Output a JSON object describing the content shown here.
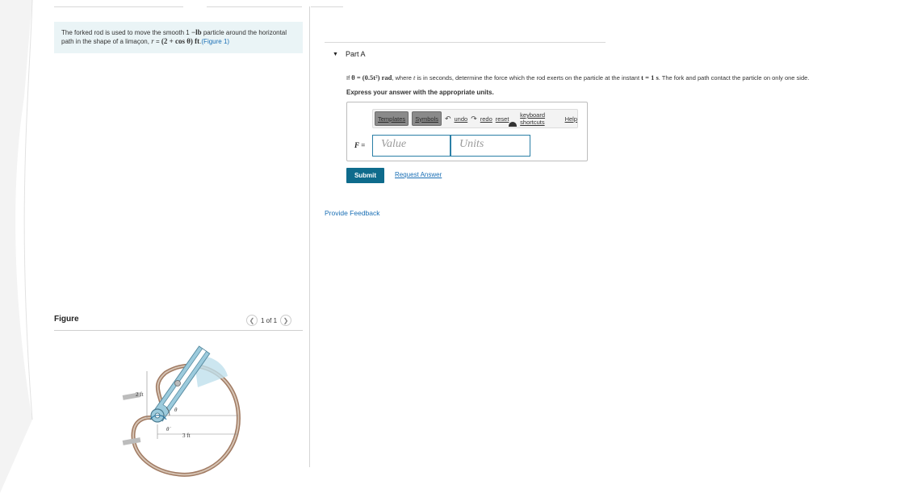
{
  "problem": {
    "text_1": "The forked rod is used to move the smooth 1",
    "weight_unit": "−lb",
    "text_2": "particle around the horizontal path in the shape of a limaçon,",
    "equation_r": "r",
    "equation_eq": " = ",
    "equation_expr": "(2 + cos θ) ft",
    "period": ".",
    "figure_link": "(Figure 1)"
  },
  "figure": {
    "title": "Figure",
    "page_indicator": "1 of 1",
    "prev_icon": "chevron-left-icon",
    "next_icon": "chevron-right-icon",
    "labels": {
      "two_ft": "2 ft",
      "three_ft": "3 ft",
      "theta": "θ",
      "theta_dot": "θ̇"
    }
  },
  "part": {
    "label": "Part A",
    "question_1": "If ",
    "theta_expr": "θ = (0.5t²) rad",
    "question_2": ", where ",
    "t_var": "t",
    "question_3": " is in seconds, determine the force which the rod exerts on the particle at the instant ",
    "t_eq": "t = 1 s",
    "question_4": ". The fork and path contact the particle on only one side.",
    "instruction": "Express your answer with the appropriate units."
  },
  "toolbar": {
    "templates": "Templates",
    "symbols": "Symbols",
    "undo": "undo",
    "redo": "redo",
    "reset": "reset",
    "shortcuts": "keyboard shortcuts",
    "help": "Help"
  },
  "answer": {
    "label": "F =",
    "value_placeholder": "Value",
    "units_placeholder": "Units"
  },
  "actions": {
    "submit": "Submit",
    "request_answer": "Request Answer",
    "feedback": "Provide Feedback"
  },
  "colors": {
    "accent": "#0e6b8c",
    "link": "#1a6fb5",
    "problem_bg": "#eaf4f6"
  }
}
